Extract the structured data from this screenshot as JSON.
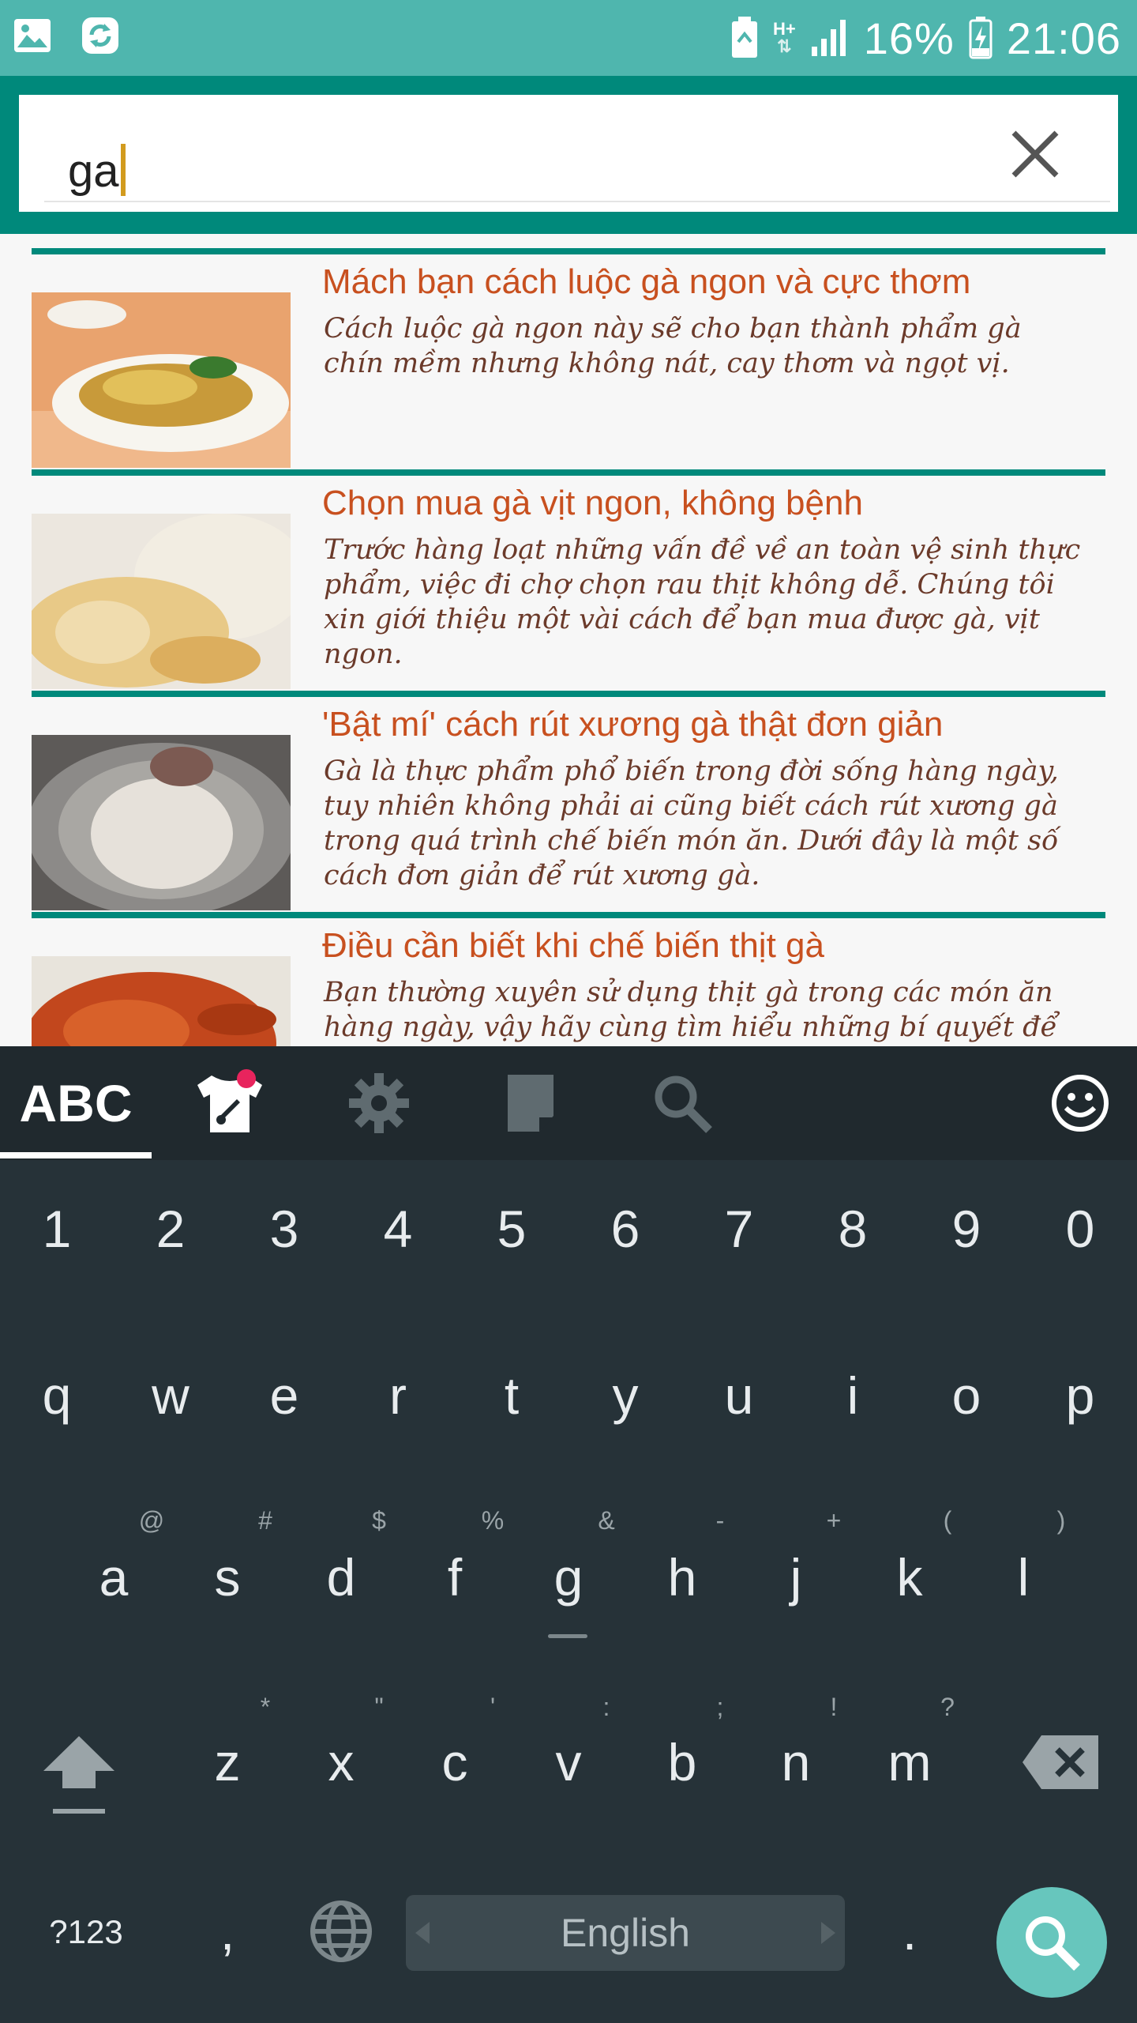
{
  "status_bar": {
    "battery_percent": "16%",
    "time": "21:06",
    "network": "H+",
    "icons": [
      "image-icon",
      "sync-icon",
      "battery-saver-icon",
      "data-arrows-icon",
      "signal-icon",
      "battery-charging-icon"
    ]
  },
  "search": {
    "query": "ga",
    "clear_icon": "close-icon"
  },
  "results": [
    {
      "title": "Mách bạn cách luộc gà ngon và cực thơm",
      "description": "Cách luộc gà ngon này sẽ cho bạn thành phẩm gà chín mềm nhưng không nát, cay thơm và ngọt vị."
    },
    {
      "title": "Chọn mua gà vịt ngon, không bệnh",
      "description": "Trước hàng loạt những vấn đề về an toàn vệ sinh thực phẩm, việc đi chợ chọn rau thịt không dễ. Chúng tôi xin giới thiệu một vài cách để bạn mua được gà, vịt ngon."
    },
    {
      "title": "'Bật mí' cách rút xương gà thật đơn giản",
      "description": "Gà là thực phẩm phổ biến trong đời sống hàng ngày, tuy nhiên không phải ai cũng biết cách rút xương gà trong quá trình chế biến món ăn. Dưới đây là một số cách đơn giản để rút xương gà."
    },
    {
      "title": "Điều cần biết khi chế biến thịt gà",
      "description": "Bạn thường xuyên sử dụng thịt gà trong các món ăn hàng ngày, vậy hãy cùng tìm hiểu những bí quyết để"
    }
  ],
  "keyboard": {
    "abc_label": "ABC",
    "number_row": [
      "1",
      "2",
      "3",
      "4",
      "5",
      "6",
      "7",
      "8",
      "9",
      "0"
    ],
    "row1": [
      "q",
      "w",
      "e",
      "r",
      "t",
      "y",
      "u",
      "i",
      "o",
      "p"
    ],
    "row2": [
      "a",
      "s",
      "d",
      "f",
      "g",
      "h",
      "j",
      "k",
      "l"
    ],
    "row2_hints": [
      "@",
      "#",
      "$",
      "%",
      "&",
      "-",
      "+",
      "(",
      ")"
    ],
    "row3": [
      "z",
      "x",
      "c",
      "v",
      "b",
      "n",
      "m"
    ],
    "row3_hints": [
      "*",
      "\"",
      "'",
      ":",
      ";",
      "!",
      "?"
    ],
    "symbols_label": "?123",
    "comma_label": ",",
    "space_label": "English",
    "period_label": ".",
    "accent_color": "#67c6bd",
    "header_color": "#00897b",
    "title_color": "#c8501f"
  }
}
